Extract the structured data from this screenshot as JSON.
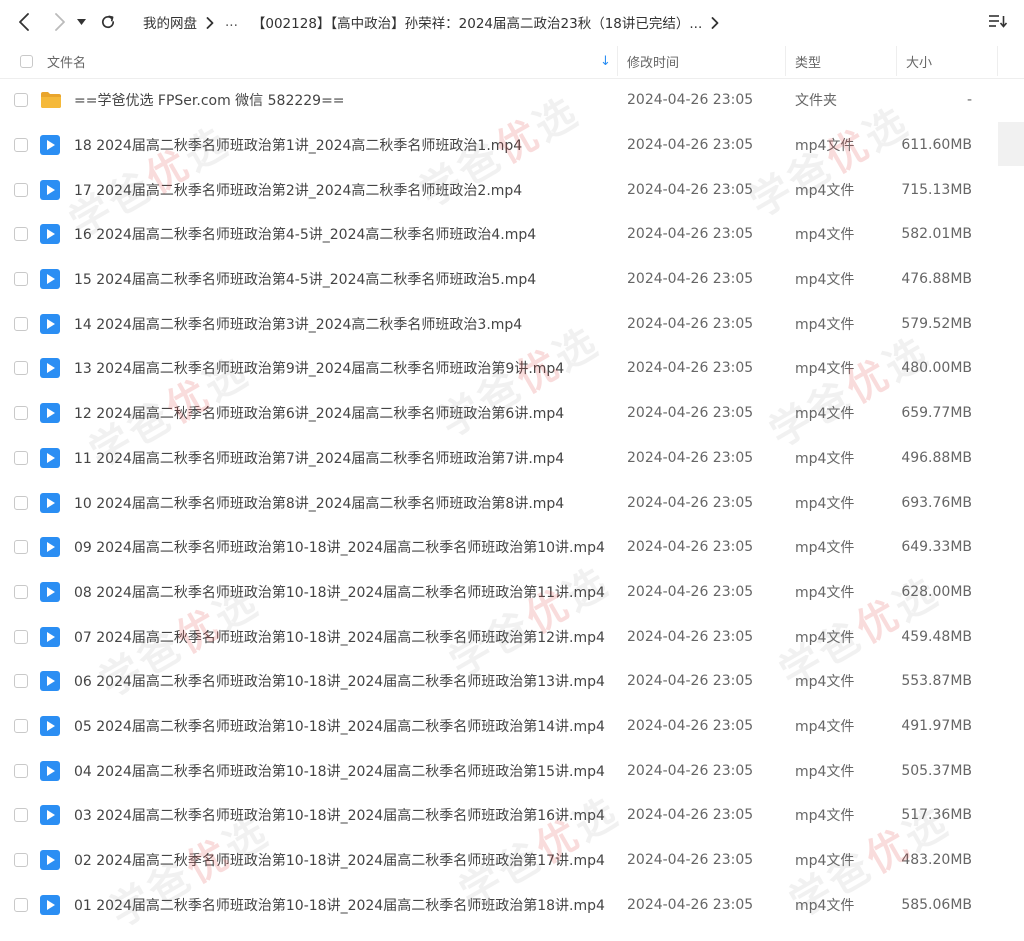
{
  "toolbar": {
    "back_icon": "chevron-left-icon",
    "forward_icon": "chevron-right-icon",
    "history_icon": "dropdown-triangle-icon",
    "refresh_icon": "refresh-icon",
    "sort_icon": "sort-list-icon"
  },
  "breadcrumb": {
    "root": "我的网盘",
    "ellipsis": "...",
    "current": "【002128】【高中政治】孙荣祥：2024届高二政治23秋（18讲已完结）..."
  },
  "header": {
    "name": "文件名",
    "modified": "修改时间",
    "type": "类型",
    "size": "大小",
    "sort_indicator": "↓"
  },
  "files": [
    {
      "kind": "folder",
      "name": "==学爸优选 FPSer.com 微信 582229==",
      "modified": "2024-04-26 23:05",
      "type": "文件夹",
      "size": "-"
    },
    {
      "kind": "video",
      "name": "18 2024届高二秋季名师班政治第1讲_2024高二秋季名师班政治1.mp4",
      "modified": "2024-04-26 23:05",
      "type": "mp4文件",
      "size": "611.60MB"
    },
    {
      "kind": "video",
      "name": "17 2024届高二秋季名师班政治第2讲_2024高二秋季名师班政治2.mp4",
      "modified": "2024-04-26 23:05",
      "type": "mp4文件",
      "size": "715.13MB"
    },
    {
      "kind": "video",
      "name": "16 2024届高二秋季名师班政治第4-5讲_2024高二秋季名师班政治4.mp4",
      "modified": "2024-04-26 23:05",
      "type": "mp4文件",
      "size": "582.01MB"
    },
    {
      "kind": "video",
      "name": "15 2024届高二秋季名师班政治第4-5讲_2024高二秋季名师班政治5.mp4",
      "modified": "2024-04-26 23:05",
      "type": "mp4文件",
      "size": "476.88MB"
    },
    {
      "kind": "video",
      "name": "14 2024届高二秋季名师班政治第3讲_2024高二秋季名师班政治3.mp4",
      "modified": "2024-04-26 23:05",
      "type": "mp4文件",
      "size": "579.52MB"
    },
    {
      "kind": "video",
      "name": "13 2024届高二秋季名师班政治第9讲_2024届高二秋季名师班政治第9讲.mp4",
      "modified": "2024-04-26 23:05",
      "type": "mp4文件",
      "size": "480.00MB"
    },
    {
      "kind": "video",
      "name": "12 2024届高二秋季名师班政治第6讲_2024届高二秋季名师班政治第6讲.mp4",
      "modified": "2024-04-26 23:05",
      "type": "mp4文件",
      "size": "659.77MB"
    },
    {
      "kind": "video",
      "name": "11 2024届高二秋季名师班政治第7讲_2024届高二秋季名师班政治第7讲.mp4",
      "modified": "2024-04-26 23:05",
      "type": "mp4文件",
      "size": "496.88MB"
    },
    {
      "kind": "video",
      "name": "10 2024届高二秋季名师班政治第8讲_2024届高二秋季名师班政治第8讲.mp4",
      "modified": "2024-04-26 23:05",
      "type": "mp4文件",
      "size": "693.76MB"
    },
    {
      "kind": "video",
      "name": "09 2024届高二秋季名师班政治第10-18讲_2024届高二秋季名师班政治第10讲.mp4",
      "modified": "2024-04-26 23:05",
      "type": "mp4文件",
      "size": "649.33MB"
    },
    {
      "kind": "video",
      "name": "08 2024届高二秋季名师班政治第10-18讲_2024届高二秋季名师班政治第11讲.mp4",
      "modified": "2024-04-26 23:05",
      "type": "mp4文件",
      "size": "628.00MB"
    },
    {
      "kind": "video",
      "name": "07 2024届高二秋季名师班政治第10-18讲_2024届高二秋季名师班政治第12讲.mp4",
      "modified": "2024-04-26 23:05",
      "type": "mp4文件",
      "size": "459.48MB"
    },
    {
      "kind": "video",
      "name": "06 2024届高二秋季名师班政治第10-18讲_2024届高二秋季名师班政治第13讲.mp4",
      "modified": "2024-04-26 23:05",
      "type": "mp4文件",
      "size": "553.87MB"
    },
    {
      "kind": "video",
      "name": "05 2024届高二秋季名师班政治第10-18讲_2024届高二秋季名师班政治第14讲.mp4",
      "modified": "2024-04-26 23:05",
      "type": "mp4文件",
      "size": "491.97MB"
    },
    {
      "kind": "video",
      "name": "04 2024届高二秋季名师班政治第10-18讲_2024届高二秋季名师班政治第15讲.mp4",
      "modified": "2024-04-26 23:05",
      "type": "mp4文件",
      "size": "505.37MB"
    },
    {
      "kind": "video",
      "name": "03 2024届高二秋季名师班政治第10-18讲_2024届高二秋季名师班政治第16讲.mp4",
      "modified": "2024-04-26 23:05",
      "type": "mp4文件",
      "size": "517.36MB"
    },
    {
      "kind": "video",
      "name": "02 2024届高二秋季名师班政治第10-18讲_2024届高二秋季名师班政治第17讲.mp4",
      "modified": "2024-04-26 23:05",
      "type": "mp4文件",
      "size": "483.20MB"
    },
    {
      "kind": "video",
      "name": "01 2024届高二秋季名师班政治第10-18讲_2024届高二秋季名师班政治第18讲.mp4",
      "modified": "2024-04-26 23:05",
      "type": "mp4文件",
      "size": "585.06MB"
    }
  ],
  "watermark": {
    "text_gray_1": "学爸",
    "text_red": "优",
    "text_gray_2": "选"
  },
  "colors": {
    "accent": "#2b8ef3",
    "folder": "#f5b93a",
    "text": "#444444",
    "muted": "#666666",
    "border": "#eeeeee"
  }
}
